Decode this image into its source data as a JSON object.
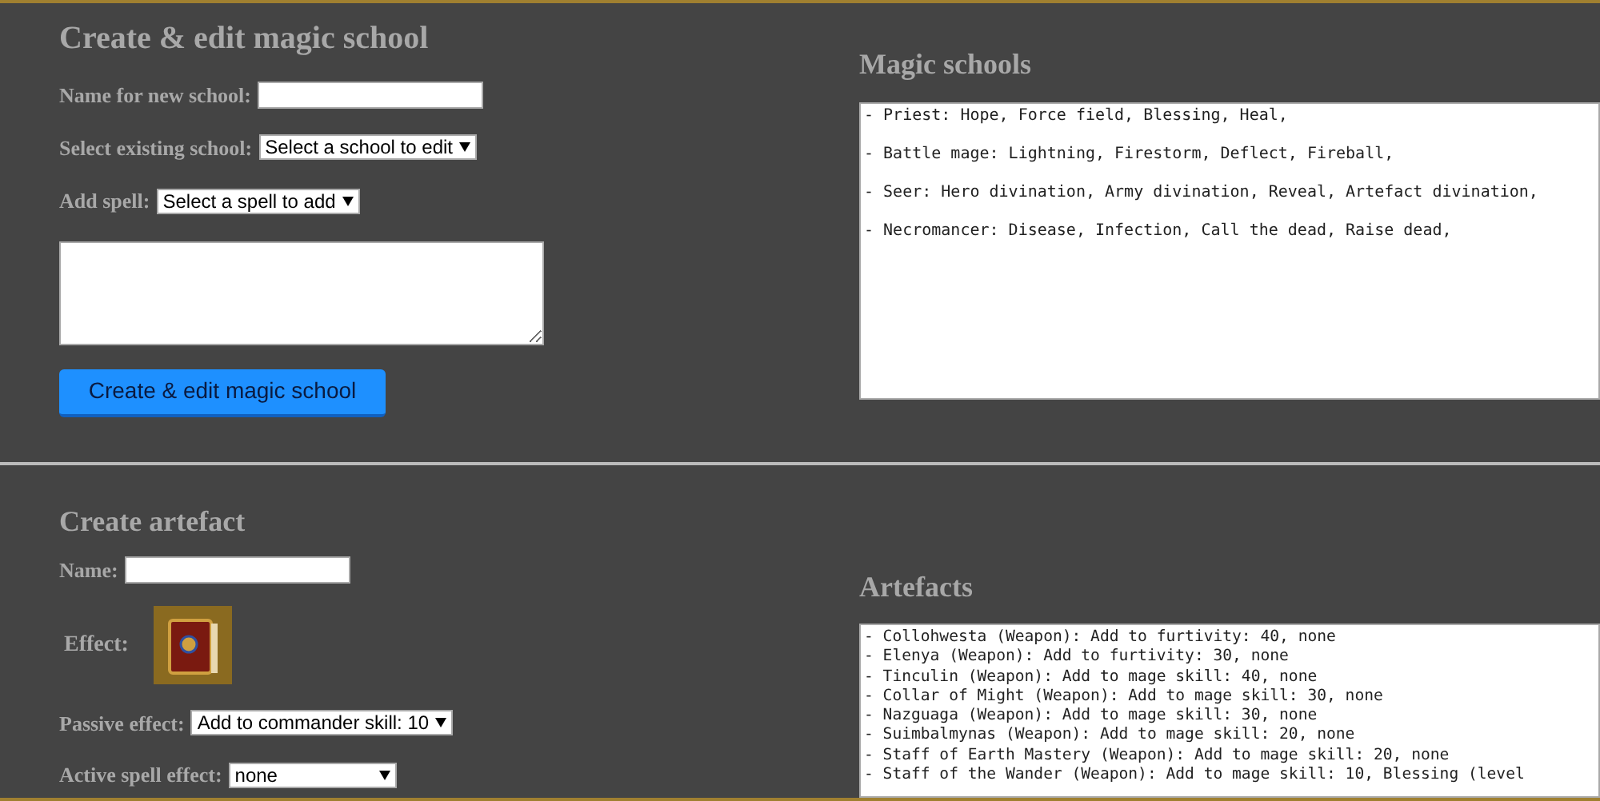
{
  "school_form": {
    "title": "Create & edit magic school",
    "name_label": "Name for new school:",
    "existing_label": "Select existing school:",
    "existing_select": "Select a school to edit",
    "spell_label": "Add spell:",
    "spell_select": "Select a spell to add",
    "button": "Create & edit magic school"
  },
  "magic_schools": {
    "title": "Magic schools",
    "lines": [
      "- Priest: Hope, Force field, Blessing, Heal,",
      "- Battle mage: Lightning, Firestorm, Deflect, Fireball,",
      "- Seer: Hero divination, Army divination, Reveal, Artefact divination,",
      "- Necromancer: Disease, Infection, Call the dead, Raise dead,"
    ]
  },
  "artefact_form": {
    "title": "Create artefact",
    "name_label": "Name:",
    "effect_label": "Effect:",
    "passive_label": "Passive effect:",
    "passive_select": "Add to commander skill: 10",
    "active_label": "Active spell effect:",
    "active_select": "none"
  },
  "artefacts": {
    "title": "Artefacts",
    "lines": [
      "- Collohwesta (Weapon): Add to furtivity: 40, none",
      "- Elenya (Weapon): Add to furtivity: 30, none",
      "- Tinculin (Weapon): Add to mage skill: 40, none",
      "- Collar of Might (Weapon): Add to mage skill: 30, none",
      "- Nazguaga (Weapon): Add to mage skill: 30, none",
      "- Suimbalmynas (Weapon): Add to mage skill: 20, none",
      "- Staff of Earth Mastery (Weapon): Add to mage skill: 20, none",
      "- Staff of the Wander (Weapon): Add to mage skill: 10, Blessing (level"
    ]
  }
}
